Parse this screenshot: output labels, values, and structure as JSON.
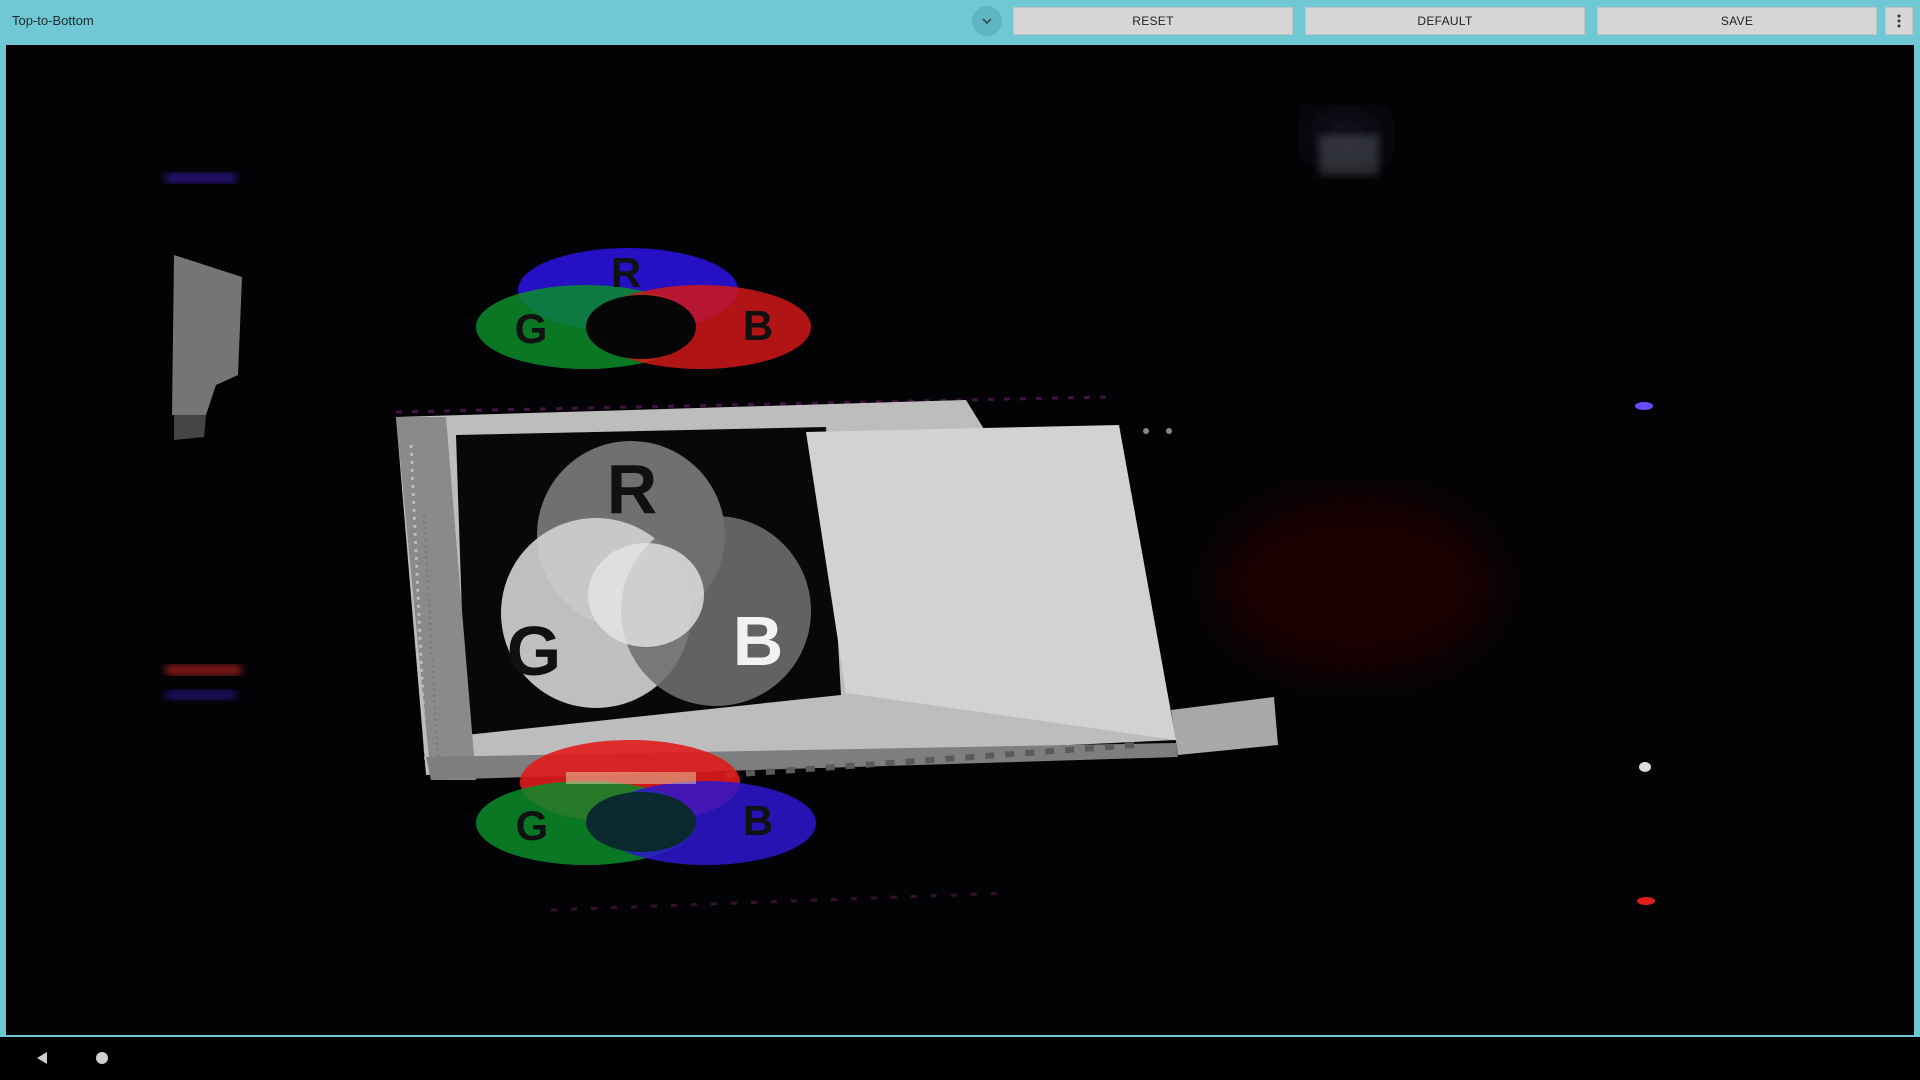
{
  "toolbar": {
    "title": "Top-to-Bottom",
    "reset_label": "RESET",
    "default_label": "DEFAULT",
    "save_label": "SAVE",
    "dropdown_icon": "chevron-down-icon",
    "more_icon": "more-vert-icon",
    "background_color": "#6fc8d3"
  },
  "preview": {
    "top_venn": {
      "r": "R",
      "g": "G",
      "b": "B"
    },
    "middle_venn": {
      "r": "R",
      "g": "G",
      "b": "B"
    },
    "bottom_venn": {
      "g": "G",
      "b": "B"
    }
  },
  "navbar": {
    "back_icon": "back-triangle-icon",
    "home_icon": "home-circle-icon"
  }
}
